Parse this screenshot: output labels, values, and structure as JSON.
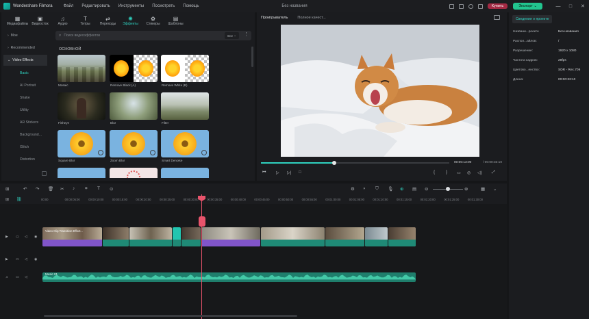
{
  "titlebar": {
    "app_name": "Wondershare Filmora",
    "menu": [
      "Файл",
      "Редактировать",
      "Инструменты",
      "Посмотреть",
      "Помощь"
    ],
    "doc_title": "Без названия",
    "buy_label": "Купить",
    "export_label": "Экспорт",
    "colors": {
      "export": "#22c58f",
      "buy": "#a42a44"
    }
  },
  "tool_tabs": [
    {
      "label": "Медиафайлы",
      "icon": "media-icon"
    },
    {
      "label": "Видеосток",
      "icon": "stock-video-icon"
    },
    {
      "label": "Аудио",
      "icon": "music-note-icon"
    },
    {
      "label": "Титры",
      "icon": "title-t-icon"
    },
    {
      "label": "Переходы",
      "icon": "transition-icon"
    },
    {
      "label": "Эффекты",
      "icon": "effects-sparkle-icon"
    },
    {
      "label": "Стикеры",
      "icon": "sticker-icon"
    },
    {
      "label": "Шаблоны",
      "icon": "template-icon"
    }
  ],
  "categories": [
    {
      "label": "Мое"
    },
    {
      "label": "Recommended"
    },
    {
      "label": "Video Effects"
    }
  ],
  "subcategories": [
    "Basic",
    "AI Portrait",
    "Shake",
    "Utility",
    "AR Stickers",
    "Background...",
    "Glitch",
    "Distortion"
  ],
  "search": {
    "placeholder": "Поиск видеоэффектов",
    "filter_label": "Все"
  },
  "grid": {
    "heading": "ОСНОВНОЙ",
    "items": [
      "Mosaic",
      "Remove Black (A)",
      "Remove White (B)",
      "Fisheye",
      "Blur",
      "Filter",
      "Square Blur",
      "Zoom Blur",
      "Smart Denoise"
    ]
  },
  "preview": {
    "tabs": [
      "Проигрыватель",
      "Полное качест..."
    ],
    "time_current": "00:00:13:00",
    "time_total": "/ 00:00:33:10",
    "progress": 0.39
  },
  "project_info": {
    "tab_label": "Сведения о проекте",
    "rows": [
      {
        "key": "Названи...роекте",
        "value": "Без названия"
      },
      {
        "key": "Распол...айлов:",
        "value": "/"
      },
      {
        "key": "Разрешение:",
        "value": "1920 x 1080"
      },
      {
        "key": "Частота кадров:",
        "value": "29fps"
      },
      {
        "key": "Цветово...енство:",
        "value": "SDR - Rec.709"
      },
      {
        "key": "Длина:",
        "value": "00:00:33:10"
      }
    ]
  },
  "timeline": {
    "ticks": [
      "00:00",
      "00:00:05:00",
      "00:00:10:00",
      "00:00:15:00",
      "00:00:20:00",
      "00:00:25:00",
      "00:00:30:00",
      "00:00:35:00",
      "00:00:40:00",
      "00:00:45:00",
      "00:00:50:00",
      "00:00:55:00",
      "00:01:00:00",
      "00:01:05:00",
      "00:01:10:00",
      "00:01:15:00",
      "00:01:20:00",
      "00:01:25:00",
      "00:01:30:00"
    ],
    "clip_label": "Video Clip Transition Effect...",
    "audio_label": "Music 01"
  }
}
